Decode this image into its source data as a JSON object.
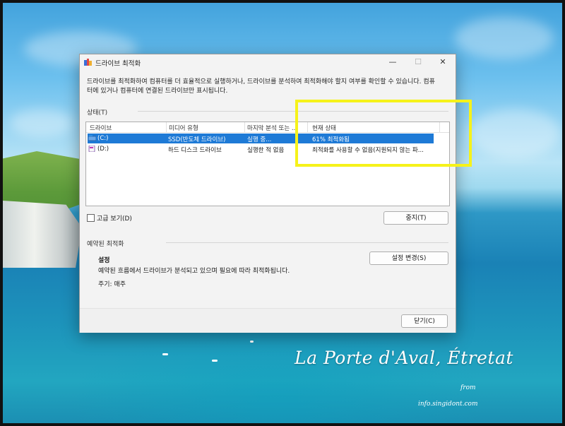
{
  "window": {
    "title": "드라이브 최적화",
    "min_icon": "—",
    "max_icon": "☐",
    "close_icon": "✕"
  },
  "description": "드라이브를 최적화하여 컴퓨터를 더 효율적으로 실행하거나, 드라이브를 분석하여 최적화해야 할지 여부를 확인할 수 있습니다. 컴퓨터에 있거나 컴퓨터에 연결된 드라이브만 표시됩니다.",
  "status_group": "상태(T)",
  "table": {
    "headers": [
      "드라이브",
      "미디어 유형",
      "마지막 분석 또는 ...",
      "현재 상태"
    ],
    "rows": [
      {
        "drive": "(C:)",
        "media": "SSD(반도체 드라이브)",
        "last": "실행 중...",
        "status": "61% 최적화됨",
        "selected": true
      },
      {
        "drive": "(D:)",
        "media": "하드 디스크 드라이브",
        "last": "실행한 적 없음",
        "status": "최적화를 사용할 수 없음(지원되지 않는 파...",
        "selected": false
      }
    ]
  },
  "advanced_label": "고급 보기(D)",
  "stop_button": "중지(T)",
  "schedule": {
    "group": "예약된 최적화",
    "title": "설정",
    "desc": "예약된 흐름에서 드라이브가 분석되고 있으며 필요에 따라 최적화됩니다.",
    "period": "주기: 매주",
    "change_button": "설정 변경(S)"
  },
  "close_button": "닫기(C)",
  "wallpaper": {
    "caption": "La Porte d'Aval, Étretat",
    "from": "from",
    "credit": "info.singidont.com"
  },
  "colors": {
    "selection": "#1e7ad6",
    "highlight": "#f6f21a"
  }
}
